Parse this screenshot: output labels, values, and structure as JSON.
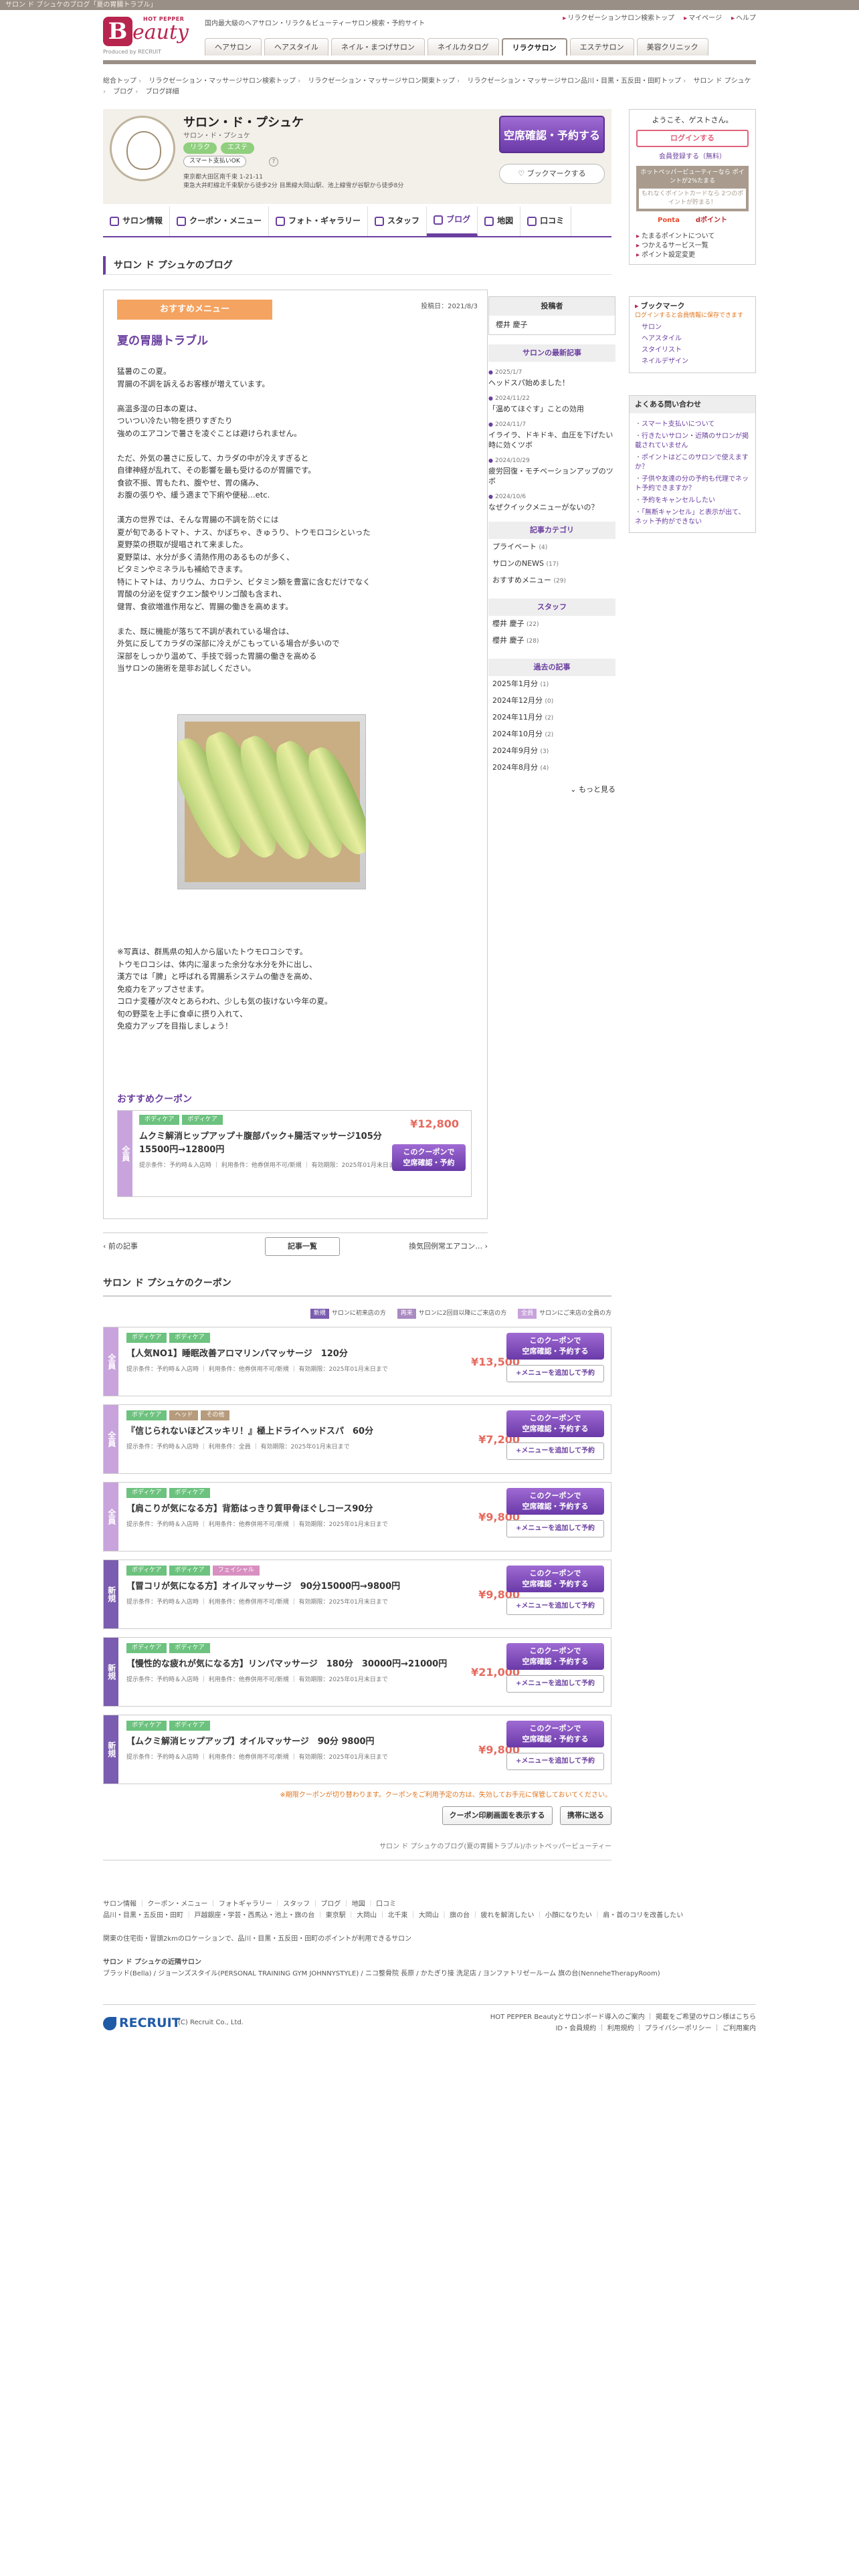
{
  "topstrip": "サロン ド ブシュケのブログ「夏の胃腸トラブル」",
  "header": {
    "hp": "HOT PEPPER",
    "logo_b": "B",
    "logo_rest": "eauty",
    "powered": "Produced by RECRUIT",
    "tagline": "国内最大級のヘアサロン・リラク＆ビューティーサロン検索・予約サイト",
    "links": [
      "リラクゼーションサロン検索トップ",
      "マイページ",
      "ヘルプ"
    ],
    "nav": [
      "ヘアサロン",
      "ヘアスタイル",
      "ネイル・まつげサロン",
      "ネイルカタログ",
      "リラクサロン",
      "エステサロン",
      "美容クリニック"
    ]
  },
  "breadcrumb": [
    "総合トップ",
    "リラクゼーション・マッサージサロン検索トップ",
    "リラクゼーション・マッサージサロン関東トップ",
    "リラクゼーション・マッサージサロン品川・目黒・五反田・田町トップ",
    "サロン ド プシュケ",
    "ブログ",
    "ブログ詳細"
  ],
  "shop": {
    "name": "サロン・ド・プシュケ",
    "kana": "サロン・ド・プシュケ",
    "tags": [
      "リラク",
      "エステ"
    ],
    "smart": "スマート支払いOK",
    "address1": "東京都大田区南千束 1-21-11",
    "address2": "東急大井町線北千束駅から徒歩2分 目黒線大岡山駅、池上線雪が谷駅から徒歩8分",
    "book_label": "空席確認・予約する",
    "bookmark_label": "ブックマークする"
  },
  "tabs": [
    "サロン情報",
    "クーポン・メニュー",
    "フォト・ギャラリー",
    "スタッフ",
    "ブログ",
    "地図",
    "口コミ"
  ],
  "blog": {
    "section_title": "サロン ド プシュケのブログ",
    "category_btn": "おすすめメニュー",
    "date": "投稿日：2021/8/3",
    "title": "夏の胃腸トラブル",
    "body1": "猛暑のこの夏。\n胃腸の不調を訴えるお客様が増えています。\n\n高温多湿の日本の夏は、\nついつい冷たい物を摂りすぎたり\n強めのエアコンで暑さを凌ぐことは避けられません。\n\nただ、外気の暑さに反して、カラダの中が冷えすぎると\n自律神経が乱れて、その影響を最も受けるのが胃腸です。\n食欲不振、胃もたれ、腹やせ、胃の痛み、\nお腹の張りや、緩う適まで下痢や便秘…etc.\n\n漢方の世界では、そんな胃腸の不調を防ぐには\n夏が旬であるトマト、ナス、かぼちゃ、きゅうり、トウモロコシといった\n夏野菜の摂取が提唱されて来ました。\n夏野菜は、水分が多く清熱作用のあるものが多く、\nビタミンやミネラルも補給できます。\n特にトマトは、カリウム、カロテン、ビタミン類を豊富に含むだけでなく\n胃酸の分泌を促すクエン酸やリンゴ酸も含まれ、\n健胃、食欲増進作用など、胃腸の働きを高めます。\n\nまた、既に機能が落ちて不調が表れている場合は、\n外気に反してカラダの深部に冷えがこもっている場合が多いので\n深部をしっかり温めて、手技で弱った胃腸の働きを高める\n当サロンの施術を是非お試しください。",
    "body2": "※写真は、群馬県の知人から届いたトウモロコシです。\nトウモロコシは、体内に溜まった余分な水分を外に出し、\n漢方では「脾」と呼ばれる胃腸系システムの働きを高め、\n免疫力をアップさせます。\nコロナ変種が次々とあらわれ、少しも気の抜けない今年の夏。\n旬の野菜を上手に食卓に摂り入れて、\n免疫力アップを目指しましょう！",
    "rec_title": "おすすめクーポン",
    "pager_prev": "前の記事",
    "pager_list": "記事一覧",
    "pager_next": "換気回例常エアコン…"
  },
  "rec_coupon": {
    "flag": "全員",
    "tags": [
      "ボディケア",
      "ボディケア"
    ],
    "price": "¥12,800",
    "name": "ムクミ解消ヒップアップ＋腹部パック+腸活マッサージ105分　15500円→12800円",
    "meta": "提示条件：予約時＆入店時 ｜ 利用条件：他券併用不可/新規 ｜ 有効期限：2025年01月末日まで",
    "btn": "このクーポンで\n空席確認・予約"
  },
  "coupons": {
    "title": "サロン ド プシュケのクーポン",
    "legend": [
      {
        "flag": "新規",
        "text": "サロンに初来店の方"
      },
      {
        "flag": "再来",
        "text": "サロンに2回目以降にご来店の方"
      },
      {
        "flag": "全員",
        "text": "サロンにご来店の全員の方"
      }
    ],
    "items": [
      {
        "flag": "全員",
        "tags": [
          "ボディケア",
          "ボディケア"
        ],
        "name": "【人気NO1】睡眠改善アロマリンパマッサージ　120分",
        "price": "¥13,500",
        "meta": "提示条件：予約時＆入店時 ｜ 利用条件：他券併用不可/新規 ｜ 有効期限：2025年01月末日まで"
      },
      {
        "flag": "全員",
        "tags": [
          "ボディケア",
          "ヘッド",
          "その他"
        ],
        "name": "『信じられないほどスッキリ！』極上ドライヘッドスパ　60分",
        "price": "¥7,200",
        "meta": "提示条件：予約時＆入店時 ｜ 利用条件：全員 ｜ 有効期限：2025年01月末日まで"
      },
      {
        "flag": "全員",
        "tags": [
          "ボディケア",
          "ボディケア"
        ],
        "name": "【肩こりが気になる方】背筋はっきり質甲骨ほぐしコース90分",
        "price": "¥9,800",
        "meta": "提示条件：予約時＆入店時 ｜ 利用条件：他券併用不可/新規 ｜ 有効期限：2025年01月末日まで"
      },
      {
        "flag": "新規",
        "tags": [
          "ボディケア",
          "ボディケア",
          "フェイシャル"
        ],
        "name": "【冒コリが気になる方】オイルマッサージ　90分15000円→9800円",
        "price": "¥9,800",
        "meta": "提示条件：予約時＆入店時 ｜ 利用条件：他券併用不可/新規 ｜ 有効期限：2025年01月末日まで"
      },
      {
        "flag": "新規",
        "tags": [
          "ボディケア",
          "ボディケア"
        ],
        "name": "【慢性的な疲れが気になる方】リンパマッサージ　180分　30000円→21000円",
        "price": "¥21,000",
        "meta": "提示条件：予約時＆入店時 ｜ 利用条件：他券併用不可/新規 ｜ 有効期限：2025年01月末日まで"
      },
      {
        "flag": "新規",
        "tags": [
          "ボディケア",
          "ボディケア"
        ],
        "name": "【ムクミ解消ヒップアップ】オイルマッサージ　90分 9800円",
        "price": "¥9,800",
        "meta": "提示条件：予約時＆入店時 ｜ 利用条件：他券併用不可/新規 ｜ 有効期限：2025年01月末日まで"
      }
    ],
    "btn1": "このクーポンで\n空席確認・予約する",
    "btn2": "+メニューを追加して予約",
    "expire": "※期限クーポンが切り替わります。クーポンをご利用予定の方は、失効してお手元に保管しておいてください。",
    "print": "クーポン印刷画面を表示する",
    "mobile": "携帯に送る",
    "caption": "サロン ド プシュケのブログ(夏の胃腸トラブル)/ホットペッパービューティー"
  },
  "sidebar": {
    "poster_h": "投稿者",
    "poster": "櫻井 慶子",
    "recent_h": "サロンの最新記事",
    "recent": [
      {
        "d": "2025/1/7",
        "t": "ヘッドスパ始めました！"
      },
      {
        "d": "2024/11/22",
        "t": "「温めてほぐす」ことの効用"
      },
      {
        "d": "2024/11/7",
        "t": "イライラ、ドキドキ、血圧を下げたい時に効くツボ"
      },
      {
        "d": "2024/10/29",
        "t": "疲労回復・モチベーションアップのツボ"
      },
      {
        "d": "2024/10/6",
        "t": "なぜクイックメニューがないの？"
      }
    ],
    "cat_h": "記事カテゴリ",
    "cats": [
      {
        "n": "プライベート",
        "c": "(4)"
      },
      {
        "n": "サロンのNEWS",
        "c": "(17)"
      },
      {
        "n": "おすすめメニュー",
        "c": "(29)"
      }
    ],
    "staff_h": "スタッフ",
    "staff": [
      {
        "n": "櫻井 慶子",
        "c": "(22)"
      },
      {
        "n": "櫻井 慶子",
        "c": "(28)"
      }
    ],
    "past_h": "過去の記事",
    "past": [
      {
        "n": "2025年1月分",
        "c": "(1)"
      },
      {
        "n": "2024年12月分",
        "c": "(0)"
      },
      {
        "n": "2024年11月分",
        "c": "(2)"
      },
      {
        "n": "2024年10月分",
        "c": "(2)"
      },
      {
        "n": "2024年9月分",
        "c": "(3)"
      },
      {
        "n": "2024年8月分",
        "c": "(4)"
      }
    ],
    "more": "もっと見る"
  },
  "rside": {
    "welcome": "ようこそ、ゲストさん。",
    "login": "ログインする",
    "register": "会員登録する（無料）",
    "promo1": "ホットペッパービューティーなら ポイントが2%たまる",
    "promo2": "もれなくポイントカードなら 2つのポイントが貯まる！",
    "logos": [
      "Ponta",
      "dポイント"
    ],
    "links": [
      "たまるポイントについて",
      "つかえるサービス一覧",
      "ポイント設定変更"
    ],
    "bm_h": "ブックマーク",
    "bm_note": "ログインすると会員情報に保存できます",
    "bm_items": [
      "サロン",
      "ヘアスタイル",
      "スタイリスト",
      "ネイルデザイン"
    ],
    "faq_h": "よくある問い合わせ",
    "faq": [
      "スマート支払いについて",
      "行きたいサロン・近隣のサロンが掲載されていません",
      "ポイントはどこのサロンで使えますか？",
      "子供や友達の分の予約も代理でネット予約できますか？",
      "予約をキャンセルしたい",
      "「無断キャンセル」と表示が出て、ネット予約ができない"
    ]
  },
  "footer": {
    "row1": [
      "サロン情報",
      "クーポン・メニュー",
      "フォトギャラリー",
      "スタッフ",
      "ブログ",
      "地図",
      "口コミ"
    ],
    "row2": [
      "品川・目黒・五反田・田町",
      "戸越銀座・学芸・西馬込・池上・旗の台",
      "東京駅",
      "大岡山",
      "北千束",
      "大岡山",
      "旗の台",
      "疲れを解消したい",
      "小顔になりたい",
      "肩・首のコリを改善したい"
    ],
    "row3": "関東の住宅街・冒頭2kmのロケーションで、品川・目黒・五反田・田町のポイントが利用できるサロン",
    "row4": "サロン ド プシュケの近隣サロン",
    "row5": "ブラッド(Bella) / ジョーンズスタイル(PERSONAL TRAINING GYM JOHNNYSTYLE) / ニコ整骨院 長原 / かたぎり接 洗足店 / ヨンファトリゼールーム 旗の台(NenneheTherapyRoom)",
    "recruit": "RECRUIT",
    "copy": "(C) Recruit Co., Ltd.",
    "right1": "HOT PEPPER Beautyとサロンボード導入のご案内 ｜ 掲載をご希望のサロン様はこちら",
    "right2": "ID・会員規約 ｜ 利用規約 ｜ プライバシーポリシー ｜ ご利用案内"
  }
}
